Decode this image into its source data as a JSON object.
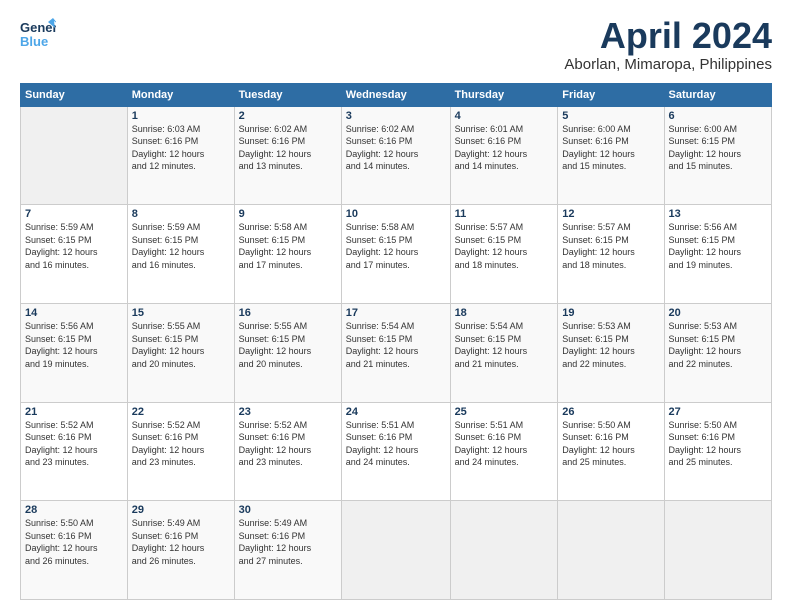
{
  "header": {
    "logo_general": "General",
    "logo_blue": "Blue",
    "title": "April 2024",
    "subtitle": "Aborlan, Mimaropa, Philippines"
  },
  "weekdays": [
    "Sunday",
    "Monday",
    "Tuesday",
    "Wednesday",
    "Thursday",
    "Friday",
    "Saturday"
  ],
  "weeks": [
    [
      {
        "day": "",
        "info": ""
      },
      {
        "day": "1",
        "info": "Sunrise: 6:03 AM\nSunset: 6:16 PM\nDaylight: 12 hours\nand 12 minutes."
      },
      {
        "day": "2",
        "info": "Sunrise: 6:02 AM\nSunset: 6:16 PM\nDaylight: 12 hours\nand 13 minutes."
      },
      {
        "day": "3",
        "info": "Sunrise: 6:02 AM\nSunset: 6:16 PM\nDaylight: 12 hours\nand 14 minutes."
      },
      {
        "day": "4",
        "info": "Sunrise: 6:01 AM\nSunset: 6:16 PM\nDaylight: 12 hours\nand 14 minutes."
      },
      {
        "day": "5",
        "info": "Sunrise: 6:00 AM\nSunset: 6:16 PM\nDaylight: 12 hours\nand 15 minutes."
      },
      {
        "day": "6",
        "info": "Sunrise: 6:00 AM\nSunset: 6:15 PM\nDaylight: 12 hours\nand 15 minutes."
      }
    ],
    [
      {
        "day": "7",
        "info": "Sunrise: 5:59 AM\nSunset: 6:15 PM\nDaylight: 12 hours\nand 16 minutes."
      },
      {
        "day": "8",
        "info": "Sunrise: 5:59 AM\nSunset: 6:15 PM\nDaylight: 12 hours\nand 16 minutes."
      },
      {
        "day": "9",
        "info": "Sunrise: 5:58 AM\nSunset: 6:15 PM\nDaylight: 12 hours\nand 17 minutes."
      },
      {
        "day": "10",
        "info": "Sunrise: 5:58 AM\nSunset: 6:15 PM\nDaylight: 12 hours\nand 17 minutes."
      },
      {
        "day": "11",
        "info": "Sunrise: 5:57 AM\nSunset: 6:15 PM\nDaylight: 12 hours\nand 18 minutes."
      },
      {
        "day": "12",
        "info": "Sunrise: 5:57 AM\nSunset: 6:15 PM\nDaylight: 12 hours\nand 18 minutes."
      },
      {
        "day": "13",
        "info": "Sunrise: 5:56 AM\nSunset: 6:15 PM\nDaylight: 12 hours\nand 19 minutes."
      }
    ],
    [
      {
        "day": "14",
        "info": "Sunrise: 5:56 AM\nSunset: 6:15 PM\nDaylight: 12 hours\nand 19 minutes."
      },
      {
        "day": "15",
        "info": "Sunrise: 5:55 AM\nSunset: 6:15 PM\nDaylight: 12 hours\nand 20 minutes."
      },
      {
        "day": "16",
        "info": "Sunrise: 5:55 AM\nSunset: 6:15 PM\nDaylight: 12 hours\nand 20 minutes."
      },
      {
        "day": "17",
        "info": "Sunrise: 5:54 AM\nSunset: 6:15 PM\nDaylight: 12 hours\nand 21 minutes."
      },
      {
        "day": "18",
        "info": "Sunrise: 5:54 AM\nSunset: 6:15 PM\nDaylight: 12 hours\nand 21 minutes."
      },
      {
        "day": "19",
        "info": "Sunrise: 5:53 AM\nSunset: 6:15 PM\nDaylight: 12 hours\nand 22 minutes."
      },
      {
        "day": "20",
        "info": "Sunrise: 5:53 AM\nSunset: 6:15 PM\nDaylight: 12 hours\nand 22 minutes."
      }
    ],
    [
      {
        "day": "21",
        "info": "Sunrise: 5:52 AM\nSunset: 6:16 PM\nDaylight: 12 hours\nand 23 minutes."
      },
      {
        "day": "22",
        "info": "Sunrise: 5:52 AM\nSunset: 6:16 PM\nDaylight: 12 hours\nand 23 minutes."
      },
      {
        "day": "23",
        "info": "Sunrise: 5:52 AM\nSunset: 6:16 PM\nDaylight: 12 hours\nand 23 minutes."
      },
      {
        "day": "24",
        "info": "Sunrise: 5:51 AM\nSunset: 6:16 PM\nDaylight: 12 hours\nand 24 minutes."
      },
      {
        "day": "25",
        "info": "Sunrise: 5:51 AM\nSunset: 6:16 PM\nDaylight: 12 hours\nand 24 minutes."
      },
      {
        "day": "26",
        "info": "Sunrise: 5:50 AM\nSunset: 6:16 PM\nDaylight: 12 hours\nand 25 minutes."
      },
      {
        "day": "27",
        "info": "Sunrise: 5:50 AM\nSunset: 6:16 PM\nDaylight: 12 hours\nand 25 minutes."
      }
    ],
    [
      {
        "day": "28",
        "info": "Sunrise: 5:50 AM\nSunset: 6:16 PM\nDaylight: 12 hours\nand 26 minutes."
      },
      {
        "day": "29",
        "info": "Sunrise: 5:49 AM\nSunset: 6:16 PM\nDaylight: 12 hours\nand 26 minutes."
      },
      {
        "day": "30",
        "info": "Sunrise: 5:49 AM\nSunset: 6:16 PM\nDaylight: 12 hours\nand 27 minutes."
      },
      {
        "day": "",
        "info": ""
      },
      {
        "day": "",
        "info": ""
      },
      {
        "day": "",
        "info": ""
      },
      {
        "day": "",
        "info": ""
      }
    ]
  ]
}
